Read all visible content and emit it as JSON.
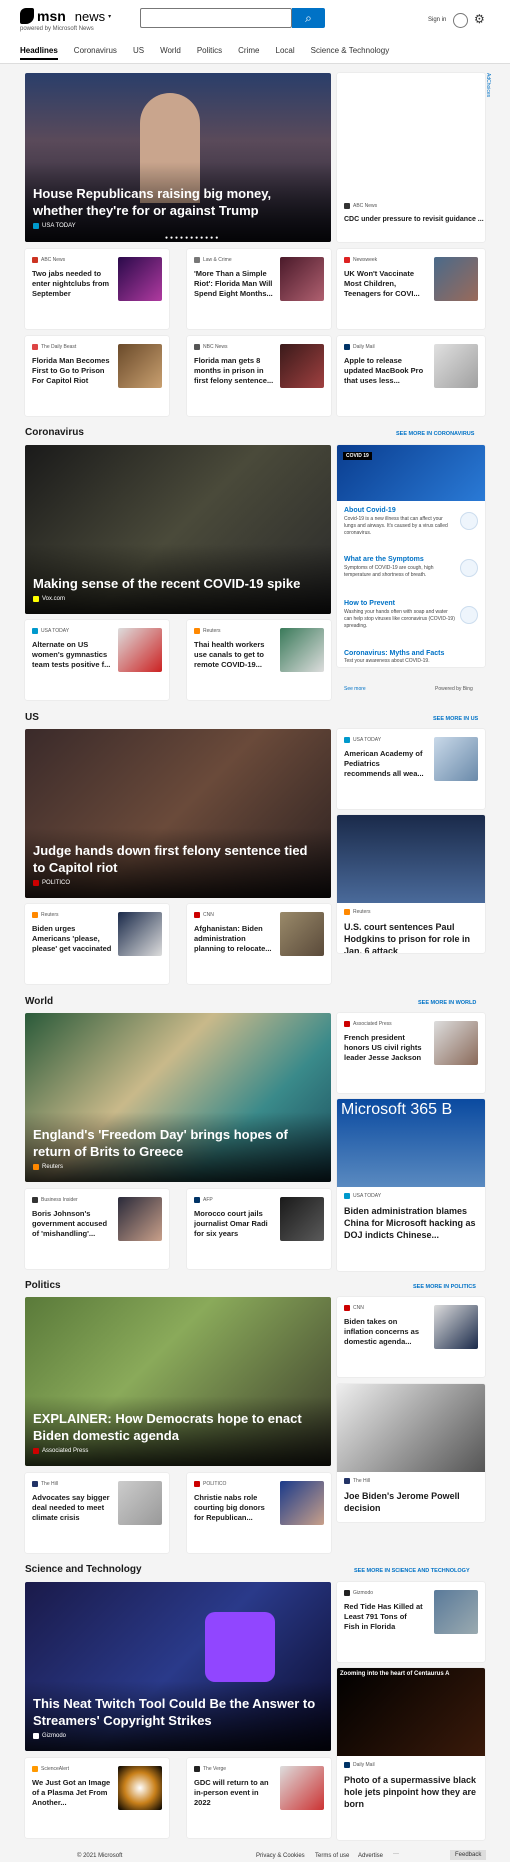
{
  "header": {
    "logo_msn": "msn",
    "logo_news": "news",
    "powered": "powered by Microsoft News",
    "signin": "Sign in",
    "search_placeholder": ""
  },
  "nav": [
    "Headlines",
    "Coronavirus",
    "US",
    "World",
    "Politics",
    "Crime",
    "Local",
    "Science & Technology"
  ],
  "ad_label": "AdChoices",
  "hero1": {
    "title": "House Republicans raising big money, whether they're for or against Trump",
    "source": "USA TODAY"
  },
  "side1": {
    "source": "ABC News",
    "title": "CDC under pressure to revisit guidance ..."
  },
  "row1": [
    {
      "source": "ABC News",
      "title": "Two jabs needed to enter nightclubs from September",
      "color": "#c32"
    },
    {
      "source": "Law & Crime",
      "title": "'More Than a Simple Riot': Florida Man Will Spend Eight Months...",
      "color": "#777"
    },
    {
      "source": "Newsweek",
      "title": "UK Won't Vaccinate Most Children, Teenagers for COVI...",
      "color": "#d22"
    }
  ],
  "row2": [
    {
      "source": "The Daily Beast",
      "title": "Florida Man Becomes First to Go to Prison For Capitol Riot",
      "color": "#d44"
    },
    {
      "source": "NBC News",
      "title": "Florida man gets 8 months in prison in first felony sentence...",
      "color": "#555"
    },
    {
      "source": "Daily Mail",
      "title": "Apple to release updated MacBook Pro that uses less...",
      "color": "#036"
    }
  ],
  "sections": {
    "coronavirus": {
      "title": "Coronavirus",
      "more": "SEE MORE IN CORONAVIRUS"
    },
    "us": {
      "title": "US",
      "more": "SEE MORE IN US"
    },
    "world": {
      "title": "World",
      "more": "SEE MORE IN WORLD"
    },
    "politics": {
      "title": "Politics",
      "more": "SEE MORE IN POLITICS"
    },
    "science": {
      "title": "Science and Technology",
      "more": "SEE MORE IN SCIENCE AND TECHNOLOGY"
    }
  },
  "covid": {
    "badge": "COVID 19",
    "items": [
      {
        "title": "About Covid-19",
        "desc": "Covid-19 is a new illness that can affect your lungs and airways. It's caused by a virus called coronavirus."
      },
      {
        "title": "What are the Symptoms",
        "desc": "Symptoms of COVID-19 are cough, high temperature and shortness of breath."
      },
      {
        "title": "How to Prevent",
        "desc": "Washing your hands often with soap and water can help stop viruses like coronavirus (COVID-19) spreading."
      },
      {
        "title": "Coronavirus: Myths and Facts",
        "desc": "Test your awareness about COVID-19."
      }
    ],
    "see_more": "See more",
    "powered": "Powered by Bing"
  },
  "hero2": {
    "title": "Making sense of the recent COVID-19 spike",
    "source": "Vox.com"
  },
  "cv_cards": [
    {
      "source": "USA TODAY",
      "title": "Alternate on US women's gymnastics team tests positive f...",
      "color": "#09c"
    },
    {
      "source": "Reuters",
      "title": "Thai health workers use canals to get to remote COVID-19...",
      "color": "#f80"
    }
  ],
  "hero3": {
    "title": "Judge hands down first felony sentence tied to Capitol riot",
    "source": "POLITICO"
  },
  "us_side": {
    "source": "USA TODAY",
    "title": "American Academy of Pediatrics recommends all wea..."
  },
  "us_tall": {
    "source": "Reuters",
    "title": "U.S. court sentences Paul Hodgkins to prison for role in Jan. 6 attack"
  },
  "us_cards": [
    {
      "source": "Reuters",
      "title": "Biden urges Americans 'please, please' get vaccinated",
      "color": "#f80"
    },
    {
      "source": "CNN",
      "title": "Afghanistan: Biden administration planning to relocate...",
      "color": "#c00"
    }
  ],
  "hero4": {
    "title": "England's 'Freedom Day' brings hopes of return of Brits to Greece",
    "source": "Reuters"
  },
  "world_side": {
    "source": "Associated Press",
    "title": "French president honors US civil rights leader Jesse Jackson"
  },
  "world_tall": {
    "source": "USA TODAY",
    "title": "Biden administration blames China for Microsoft hacking as DOJ indicts Chinese...",
    "img_text": "Microsoft 365 B"
  },
  "world_cards": [
    {
      "source": "Business Insider",
      "title": "Boris Johnson's government accused of 'mishandling'...",
      "color": "#333"
    },
    {
      "source": "AFP",
      "title": "Morocco court jails journalist Omar Radi for six years",
      "color": "#036"
    }
  ],
  "hero5": {
    "title": "EXPLAINER: How Democrats hope to enact Biden domestic agenda",
    "source": "Associated Press"
  },
  "pol_side": {
    "source": "CNN",
    "title": "Biden takes on inflation concerns as domestic agenda..."
  },
  "pol_tall": {
    "source": "The Hill",
    "title": "Joe Biden's Jerome Powell decision"
  },
  "pol_cards": [
    {
      "source": "The Hill",
      "title": "Advocates say bigger deal needed to meet climate crisis",
      "color": "#236"
    },
    {
      "source": "POLITICO",
      "title": "Christie nabs role courting big donors for Republican...",
      "color": "#c00"
    }
  ],
  "hero6": {
    "title": "This Neat Twitch Tool Could Be the Answer to Streamers' Copyright Strikes",
    "source": "Gizmodo"
  },
  "sci_side": {
    "source": "Gizmodo",
    "title": "Red Tide Has Killed at Least 791 Tons of Fish in Florida"
  },
  "sci_tall": {
    "source": "Daily Mail",
    "title": "Photo of a supermassive black hole jets pinpoint how they are born",
    "img_text": "Zooming into the heart of Centaurus A"
  },
  "sci_cards": [
    {
      "source": "ScienceAlert",
      "title": "We Just Got an Image of a Plasma Jet From Another...",
      "color": "#f90"
    },
    {
      "source": "The Verge",
      "title": "GDC will return to an in-person event in 2022",
      "color": "#222"
    }
  ],
  "footer": {
    "copyright": "© 2021 Microsoft",
    "privacy": "Privacy & Cookies",
    "terms": "Terms of use",
    "advertise": "Advertise",
    "feedback": "Feedback"
  }
}
